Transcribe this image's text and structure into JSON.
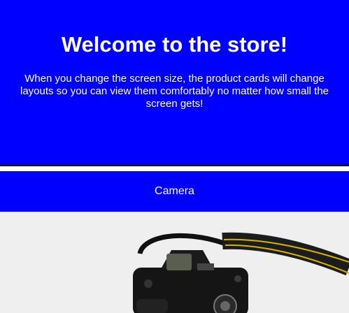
{
  "hero": {
    "title": "Welcome to the store!",
    "description": "When you change the screen size, the product cards will change layouts so you can view them comfortably no matter how small the screen gets!"
  },
  "products": [
    {
      "name": "Camera",
      "image_icon": "camera-icon"
    }
  ],
  "colors": {
    "brand_blue": "#0000ff",
    "text_on_brand": "#ffffff",
    "image_background": "#efefef"
  }
}
